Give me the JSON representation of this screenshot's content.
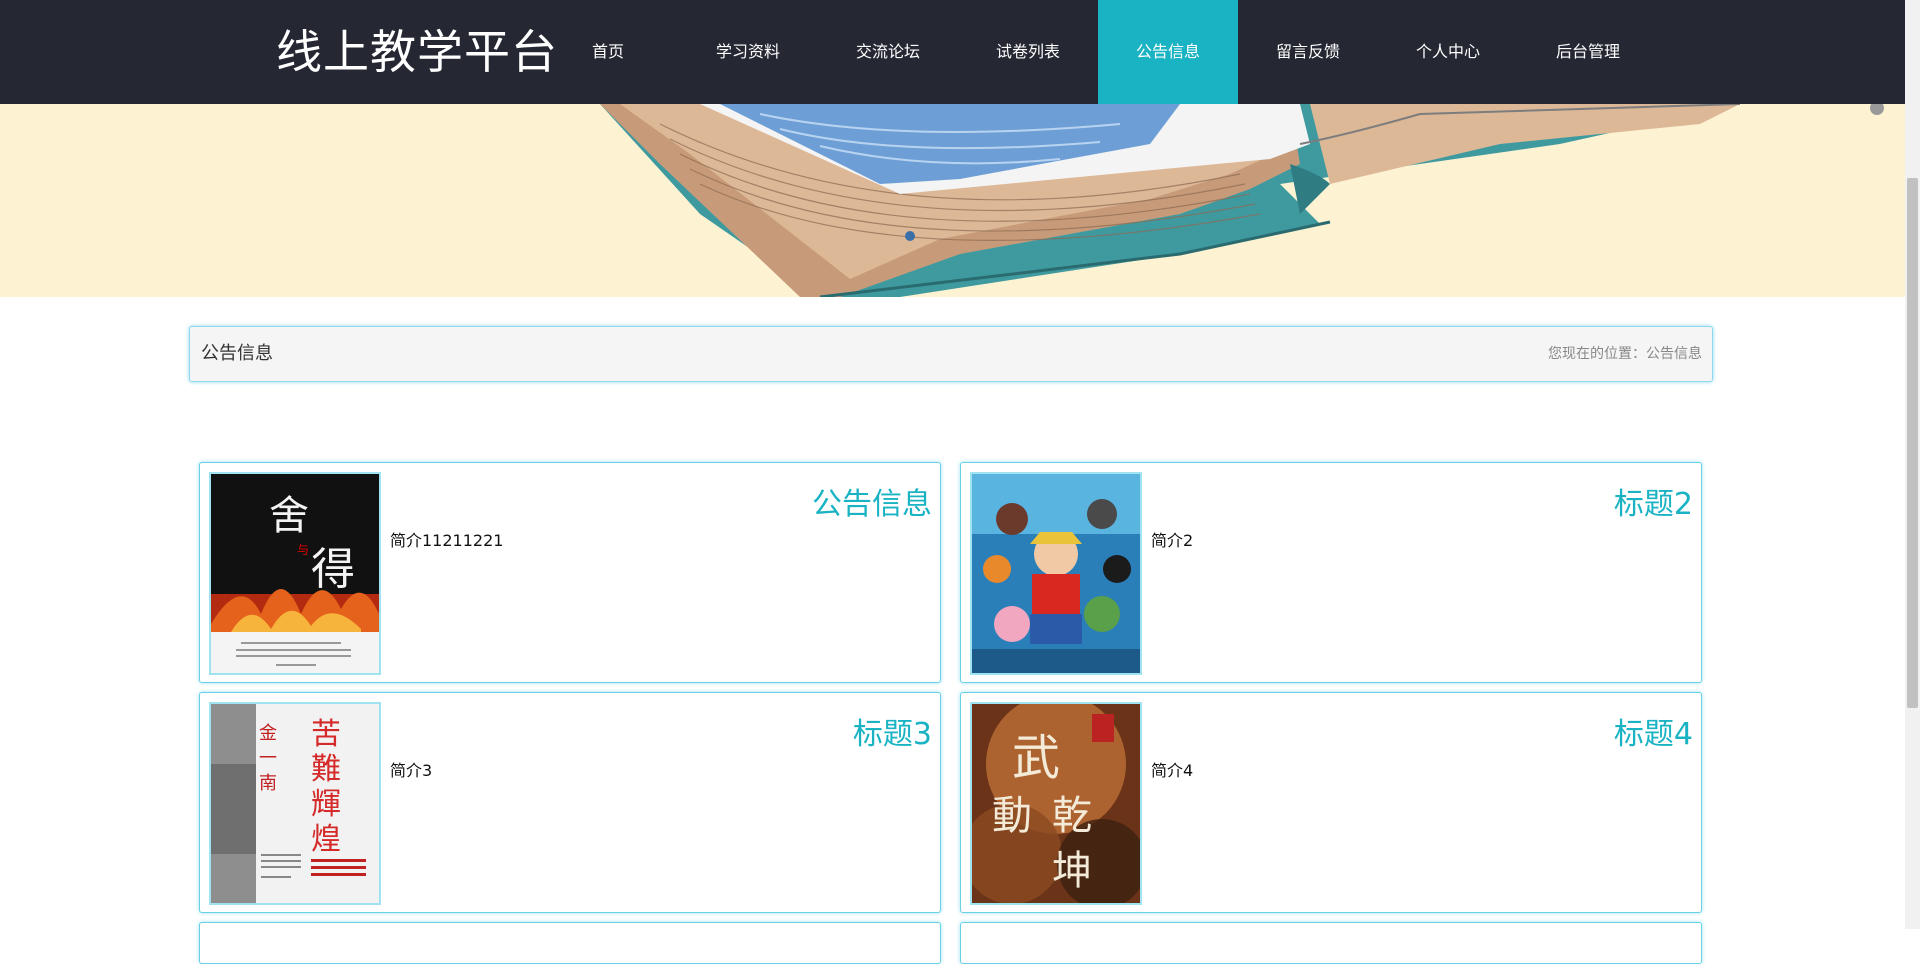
{
  "header": {
    "brand": "线上教学平台",
    "nav": [
      {
        "label": "首页",
        "active": false
      },
      {
        "label": "学习资料",
        "active": false
      },
      {
        "label": "交流论坛",
        "active": false
      },
      {
        "label": "试卷列表",
        "active": false
      },
      {
        "label": "公告信息",
        "active": true
      },
      {
        "label": "留言反馈",
        "active": false
      },
      {
        "label": "个人中心",
        "active": false
      },
      {
        "label": "后台管理",
        "active": false
      }
    ]
  },
  "breadcrumb": {
    "title": "公告信息",
    "location": "您现在的位置：公告信息"
  },
  "announcements": [
    {
      "title": "公告信息",
      "summary": "简介11211221",
      "cover": "book-cover-shede"
    },
    {
      "title": "标题2",
      "summary": "简介2",
      "cover": "anime-cover-onepiece"
    },
    {
      "title": "标题3",
      "summary": "简介3",
      "cover": "book-cover-kunan-huihuang"
    },
    {
      "title": "标题4",
      "summary": "简介4",
      "cover": "book-cover-wudong-qiankun"
    }
  ],
  "colors": {
    "nav_bg": "#252833",
    "accent": "#1ab3c4",
    "banner_bg": "#fdf3d2",
    "card_border": "#69d0e6"
  }
}
